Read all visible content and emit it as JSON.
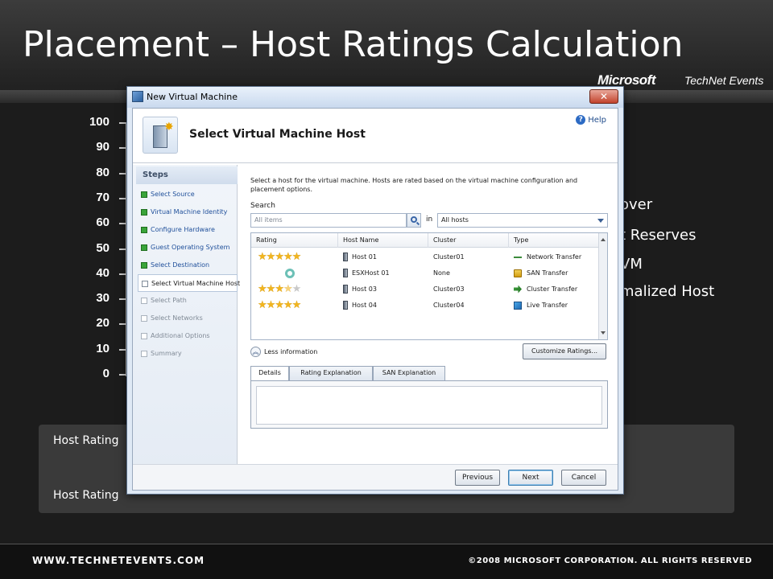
{
  "slide": {
    "title": "Placement – Host Ratings Calculation",
    "brand_microsoft": "Microsoft",
    "brand_technet": "TechNet Events",
    "footer_left": "WWW.TECHNETEVENTS.COM",
    "footer_right": "©2008 MICROSOFT CORPORATION. ALL RIGHTS RESERVED",
    "legend_items": [
      "over",
      "t Reserves",
      "VM",
      "malized Host"
    ],
    "info_lines": [
      "Host Rating",
      "Host Rating"
    ]
  },
  "axis": {
    "ticks": [
      "100",
      "90",
      "80",
      "70",
      "60",
      "50",
      "40",
      "30",
      "20",
      "10",
      "0"
    ]
  },
  "dialog": {
    "title": "New Virtual Machine",
    "close_label": "✕",
    "header_title": "Select Virtual Machine Host",
    "help_label": "Help",
    "help_glyph": "?",
    "steps_title": "Steps",
    "steps": [
      {
        "label": "Select Source",
        "status": "done"
      },
      {
        "label": "Virtual Machine Identity",
        "status": "done"
      },
      {
        "label": "Configure Hardware",
        "status": "done"
      },
      {
        "label": "Guest Operating System",
        "status": "done"
      },
      {
        "label": "Select Destination",
        "status": "done"
      },
      {
        "label": "Select Virtual Machine Host",
        "status": "current"
      },
      {
        "label": "Select Path",
        "status": "pending"
      },
      {
        "label": "Select Networks",
        "status": "pending"
      },
      {
        "label": "Additional Options",
        "status": "pending"
      },
      {
        "label": "Summary",
        "status": "pending"
      }
    ],
    "instructions": "Select a host for the virtual machine. Hosts are rated based on the virtual machine configuration and placement options.",
    "search": {
      "label": "Search",
      "placeholder": "All items",
      "in_label": "in",
      "scope_value": "All hosts"
    },
    "table": {
      "columns": [
        "Rating",
        "Host Name",
        "Cluster",
        "Type"
      ],
      "rows": [
        {
          "rating": 5,
          "host": "Host 01",
          "cluster": "Cluster01",
          "type": "Network Transfer",
          "type_icon": "network-transfer-icon"
        },
        {
          "rating": null,
          "host": "ESXHost 01",
          "cluster": "None",
          "type": "SAN Transfer",
          "type_icon": "san-transfer-icon"
        },
        {
          "rating": 3.5,
          "host": "Host 03",
          "cluster": "Cluster03",
          "type": "Cluster Transfer",
          "type_icon": "cluster-transfer-icon"
        },
        {
          "rating": 5,
          "host": "Host 04",
          "cluster": "Cluster04",
          "type": "Live Transfer",
          "type_icon": "live-transfer-icon"
        }
      ]
    },
    "less_info_label": "Less information",
    "customize_label": "Customize Ratings...",
    "tabs": [
      "Details",
      "Rating Explanation",
      "SAN Explanation"
    ],
    "buttons": {
      "previous": "Previous",
      "next": "Next",
      "cancel": "Cancel"
    }
  }
}
